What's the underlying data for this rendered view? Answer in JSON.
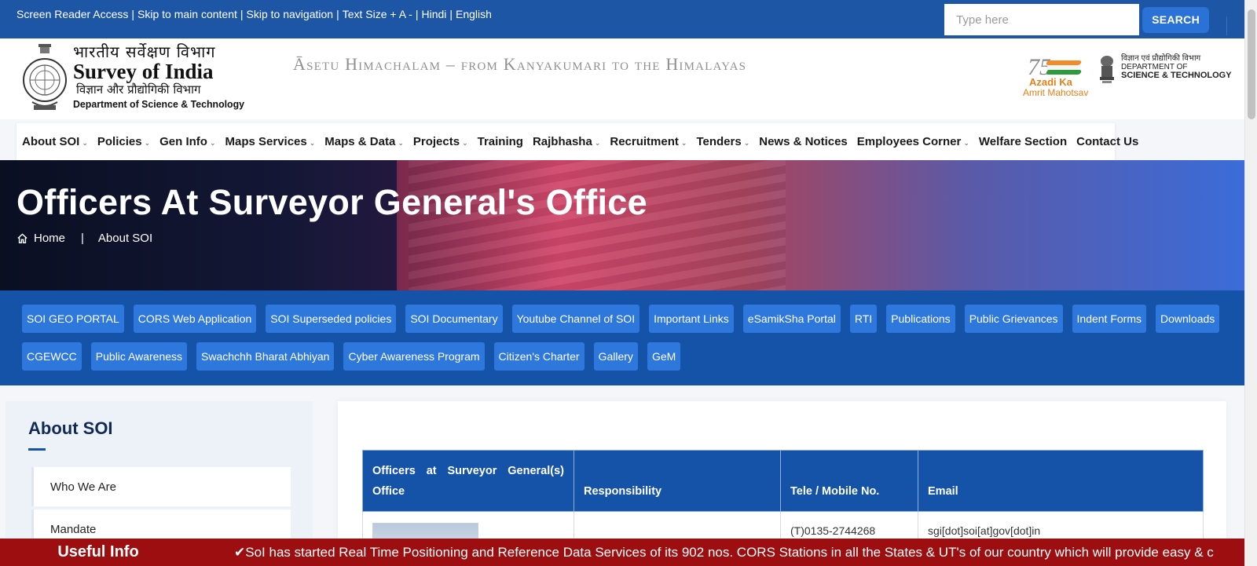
{
  "topbar": {
    "links": [
      "Screen Reader Access",
      "Skip to main content",
      "Skip to navigation",
      "Text Size + A -",
      "Hindi",
      "English"
    ],
    "search_placeholder": "Type here",
    "search_button": "SEARCH"
  },
  "header": {
    "logo_hindi": "भारतीय सर्वेक्षण विभाग",
    "logo_english": "Survey of India",
    "logo_hindi_dept": "विज्ञान और प्रौद्योगिकी विभाग",
    "logo_dept": "Department of Science & Technology",
    "tagline": "Āsetu Himachalam – from Kanyakumari to the Himalayas",
    "azadi_line1": "Azadi Ka",
    "azadi_line2": "Amrit Mahotsav",
    "dst_hindi": "विज्ञान एवं प्रौद्योगिकी विभाग",
    "dst_line1": "DEPARTMENT OF",
    "dst_line2": "SCIENCE & TECHNOLOGY"
  },
  "nav": {
    "items": [
      {
        "label": "About SOI",
        "dropdown": true
      },
      {
        "label": "Policies",
        "dropdown": true
      },
      {
        "label": "Gen Info",
        "dropdown": true
      },
      {
        "label": "Maps Services",
        "dropdown": true
      },
      {
        "label": "Maps & Data",
        "dropdown": true
      },
      {
        "label": "Projects",
        "dropdown": true
      },
      {
        "label": "Training",
        "dropdown": false
      },
      {
        "label": "Rajbhasha",
        "dropdown": true
      },
      {
        "label": "Recruitment",
        "dropdown": true
      },
      {
        "label": "Tenders",
        "dropdown": true
      },
      {
        "label": "News & Notices",
        "dropdown": false
      },
      {
        "label": "Employees Corner",
        "dropdown": true
      },
      {
        "label": "Welfare Section",
        "dropdown": false
      },
      {
        "label": "Contact Us",
        "dropdown": false
      }
    ]
  },
  "banner": {
    "title": "Officers At Surveyor General's Office",
    "breadcrumb_home": "Home",
    "breadcrumb_sep": "|",
    "breadcrumb_current": "About SOI"
  },
  "quicklinks": [
    "SOI GEO PORTAL",
    "CORS Web Application",
    "SOI Superseded policies",
    "SOI Documentary",
    "Youtube Channel of SOI",
    "Important Links",
    "eSamikSha Portal",
    "RTI",
    "Publications",
    "Public Grievances",
    "Indent Forms",
    "Downloads",
    "CGEWCC",
    "Public Awareness",
    "Swachchh Bharat Abhiyan",
    "Cyber Awareness Program",
    "Citizen's Charter",
    "Gallery",
    "GeM"
  ],
  "sidebar": {
    "title": "About SOI",
    "items": [
      "Who We Are",
      "Mandate"
    ]
  },
  "table": {
    "headers": [
      "Officers at Surveyor General(s) Office",
      "Responsibility",
      "Tele / Mobile No.",
      "Email"
    ],
    "rows": [
      {
        "responsibility": "",
        "tele": "(T)0135-2744268",
        "email": "sgi[dot]soi[at]gov[dot]in"
      }
    ]
  },
  "ticker": {
    "label": "Useful Info",
    "text": "✔SoI has started Real Time Positioning and Reference Data Services of its 902 nos. CORS Stations in all the States & UT's of our country which will provide easy & c"
  },
  "colors": {
    "topbar": "#1e56a6",
    "quicklinks_bg": "#1553a8",
    "quicklink_btn": "#2d77dd",
    "ticker_bg": "#9c0e10"
  }
}
